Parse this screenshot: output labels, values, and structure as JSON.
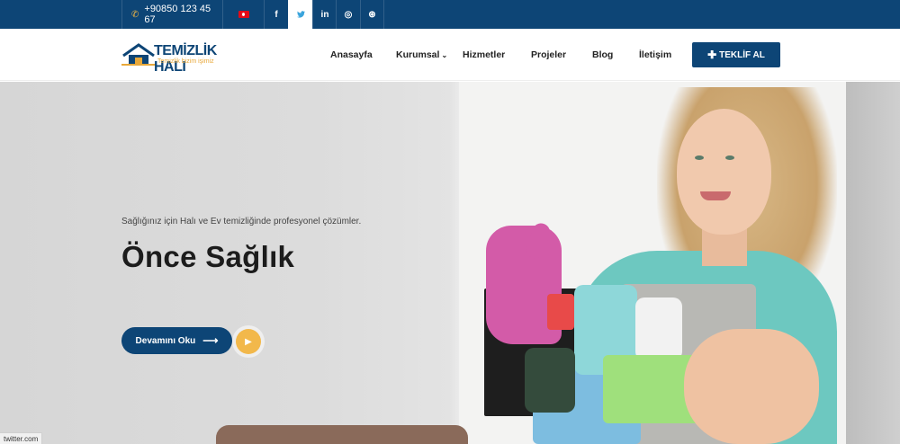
{
  "topbar": {
    "phone": "+90850 123 45 67",
    "phone_icon": "phone-icon",
    "flag_icon": "turkey-flag-icon",
    "social": [
      {
        "label": "f",
        "icon": "facebook-icon"
      },
      {
        "label": "🐦",
        "icon": "twitter-icon"
      },
      {
        "label": "in",
        "icon": "linkedin-icon"
      },
      {
        "label": "◎",
        "icon": "instagram-icon"
      },
      {
        "label": "⊛",
        "icon": "dribbble-icon"
      }
    ]
  },
  "header": {
    "logo_brand": "TEMİZLİK HALI",
    "logo_tagline": "Temizlik bizim işimiz",
    "nav": [
      "Anasayfa",
      "Kurumsal",
      "Hizmetler",
      "Projeler",
      "Blog",
      "İletişim"
    ],
    "nav_dropdown_icon": "chevron-down-icon",
    "cta_label": "TEKLİF AL",
    "cta_icon": "plus-icon"
  },
  "hero": {
    "subtitle": "Sağlığınız için Halı ve Ev temizliğinde profesyonel çözümler.",
    "title": "Önce Sağlık",
    "button_label": "Devamını Oku",
    "button_icon": "arrow-right-icon",
    "play_icon": "play-icon"
  },
  "status_bar": "twitter.com",
  "colors": {
    "primary": "#0d4576",
    "accent": "#f2b84b",
    "twitter_blue": "#3aa4dc"
  }
}
